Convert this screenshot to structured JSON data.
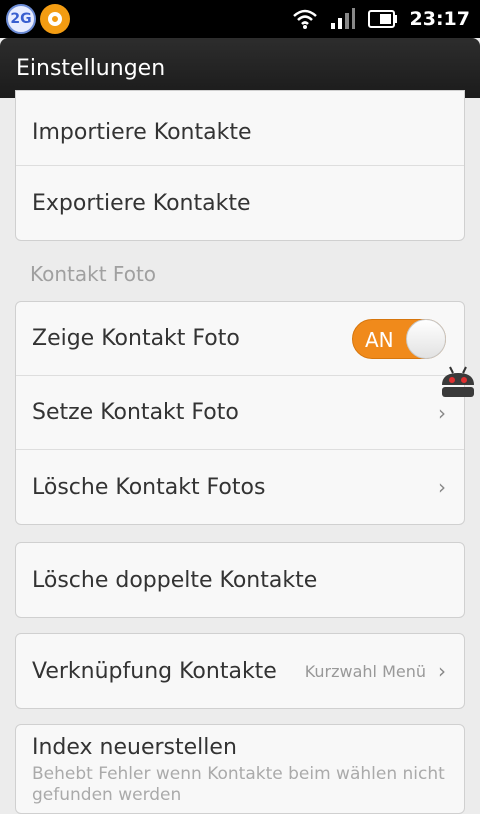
{
  "statusbar": {
    "network": "2G",
    "time": "23:17"
  },
  "titlebar": {
    "title": "Einstellungen"
  },
  "import_export": [
    {
      "label": "Importiere Kontakte"
    },
    {
      "label": "Exportiere Kontakte"
    }
  ],
  "photo_section": {
    "header": "Kontakt Foto",
    "show_photo": {
      "label": "Zeige Kontakt Foto",
      "toggle_state": "AN",
      "toggle_on": true
    },
    "set_photo": {
      "label": "Setze Kontakt Foto"
    },
    "delete_photos": {
      "label": "Lösche Kontakt Fotos"
    }
  },
  "duplicates": {
    "label": "Lösche doppelte Kontakte"
  },
  "links": {
    "label": "Verknüpfung Kontakte",
    "value": "Kurzwahl Menü"
  },
  "index": {
    "title": "Index neuerstellen",
    "subtitle": "Behebt Fehler wenn Kontakte beim wählen nicht gefunden werden"
  },
  "colors": {
    "accent": "#f08a1b",
    "titlebar": "#222222",
    "background": "#ececec"
  }
}
